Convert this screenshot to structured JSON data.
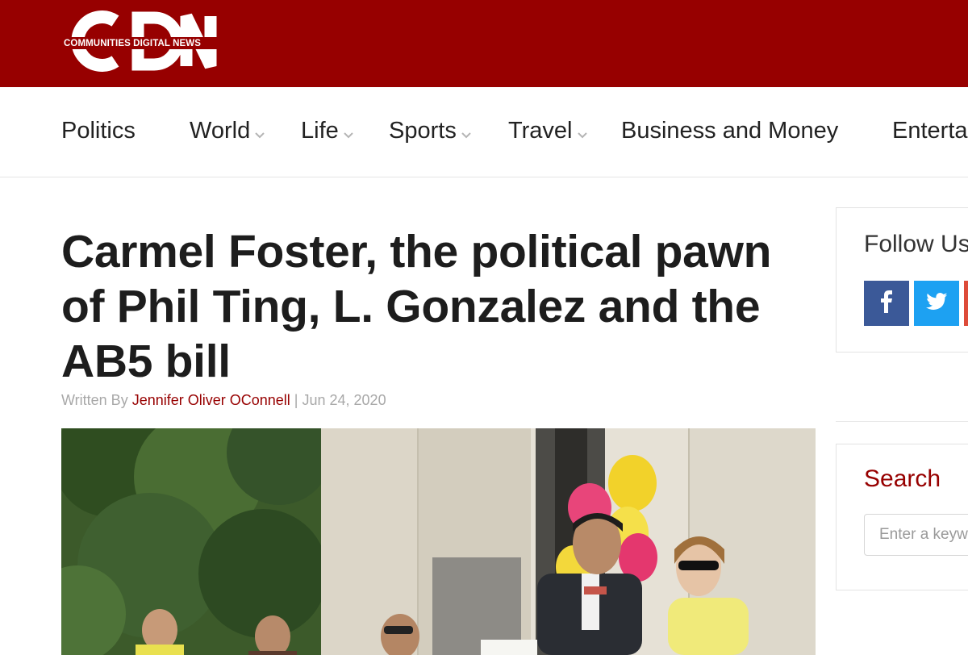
{
  "brand": {
    "logo_letters": "CDN",
    "tagline": "COMMUNITIES DIGITAL NEWS",
    "color": "#970000"
  },
  "nav": {
    "items": [
      {
        "label": "Politics",
        "dropdown": false
      },
      {
        "label": "World",
        "dropdown": true
      },
      {
        "label": "Life",
        "dropdown": true
      },
      {
        "label": "Sports",
        "dropdown": true
      },
      {
        "label": "Travel",
        "dropdown": true
      },
      {
        "label": "Business and Money",
        "dropdown": false
      },
      {
        "label": "Enterta",
        "dropdown": false
      }
    ]
  },
  "article": {
    "title": "Carmel Foster, the political pawn of Phil Ting, L. Gonzalez and the AB5 bill",
    "byline_prefix": "Written By ",
    "author": "Jennifer Oliver OConnell",
    "byline_sep": " | ",
    "date": "Jun 24, 2020"
  },
  "sidebar": {
    "follow_title": "Follow Us",
    "social": [
      {
        "icon": "facebook-icon",
        "color": "#3b5998"
      },
      {
        "icon": "twitter-icon",
        "color": "#1da1f2"
      },
      {
        "icon": "google-plus-icon",
        "color": "#dd4b39"
      }
    ],
    "search_title": "Search",
    "search_placeholder": "Enter a keyword"
  }
}
